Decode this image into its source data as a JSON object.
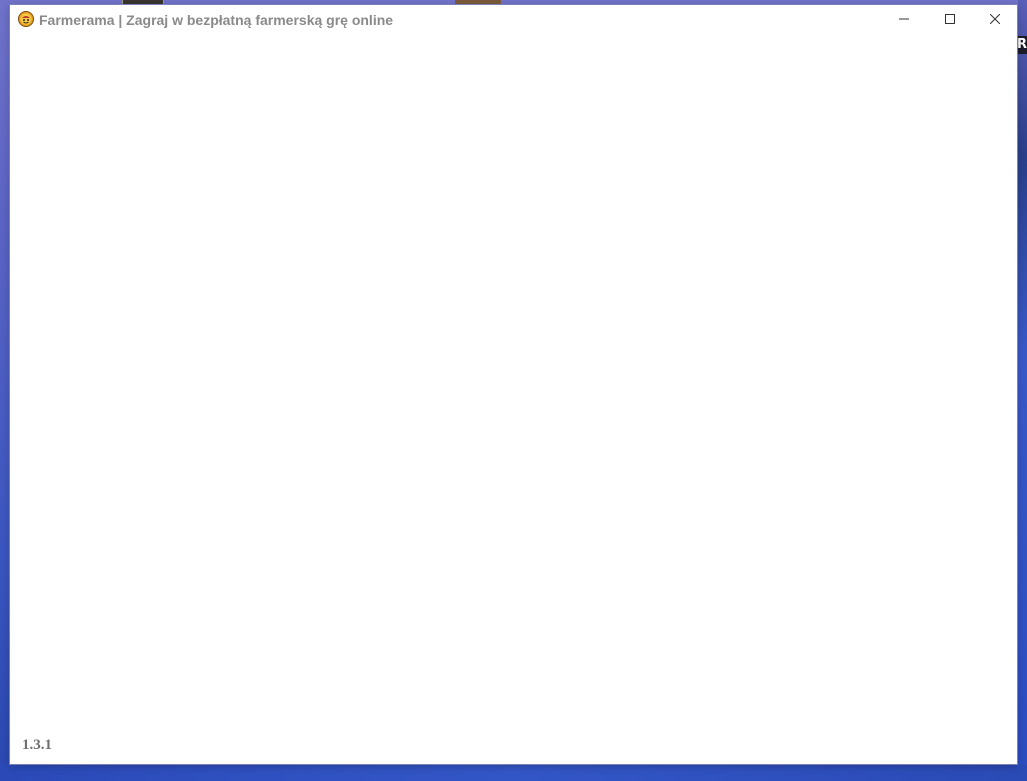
{
  "window": {
    "title": "Farmerama | Zagraj w bezpłatną farmerską grę online",
    "app_icon": "farmerama-logo-icon",
    "controls": {
      "minimize_icon": "minimize-icon",
      "maximize_icon": "maximize-icon",
      "close_icon": "close-icon"
    }
  },
  "content": {
    "version": "1.3.1"
  },
  "desktop": {
    "right_edge_glyph": "R"
  },
  "colors": {
    "title_text": "#8a8a8a",
    "version_text": "#6e6e6e",
    "desktop_bg": "#4a5cc4"
  }
}
